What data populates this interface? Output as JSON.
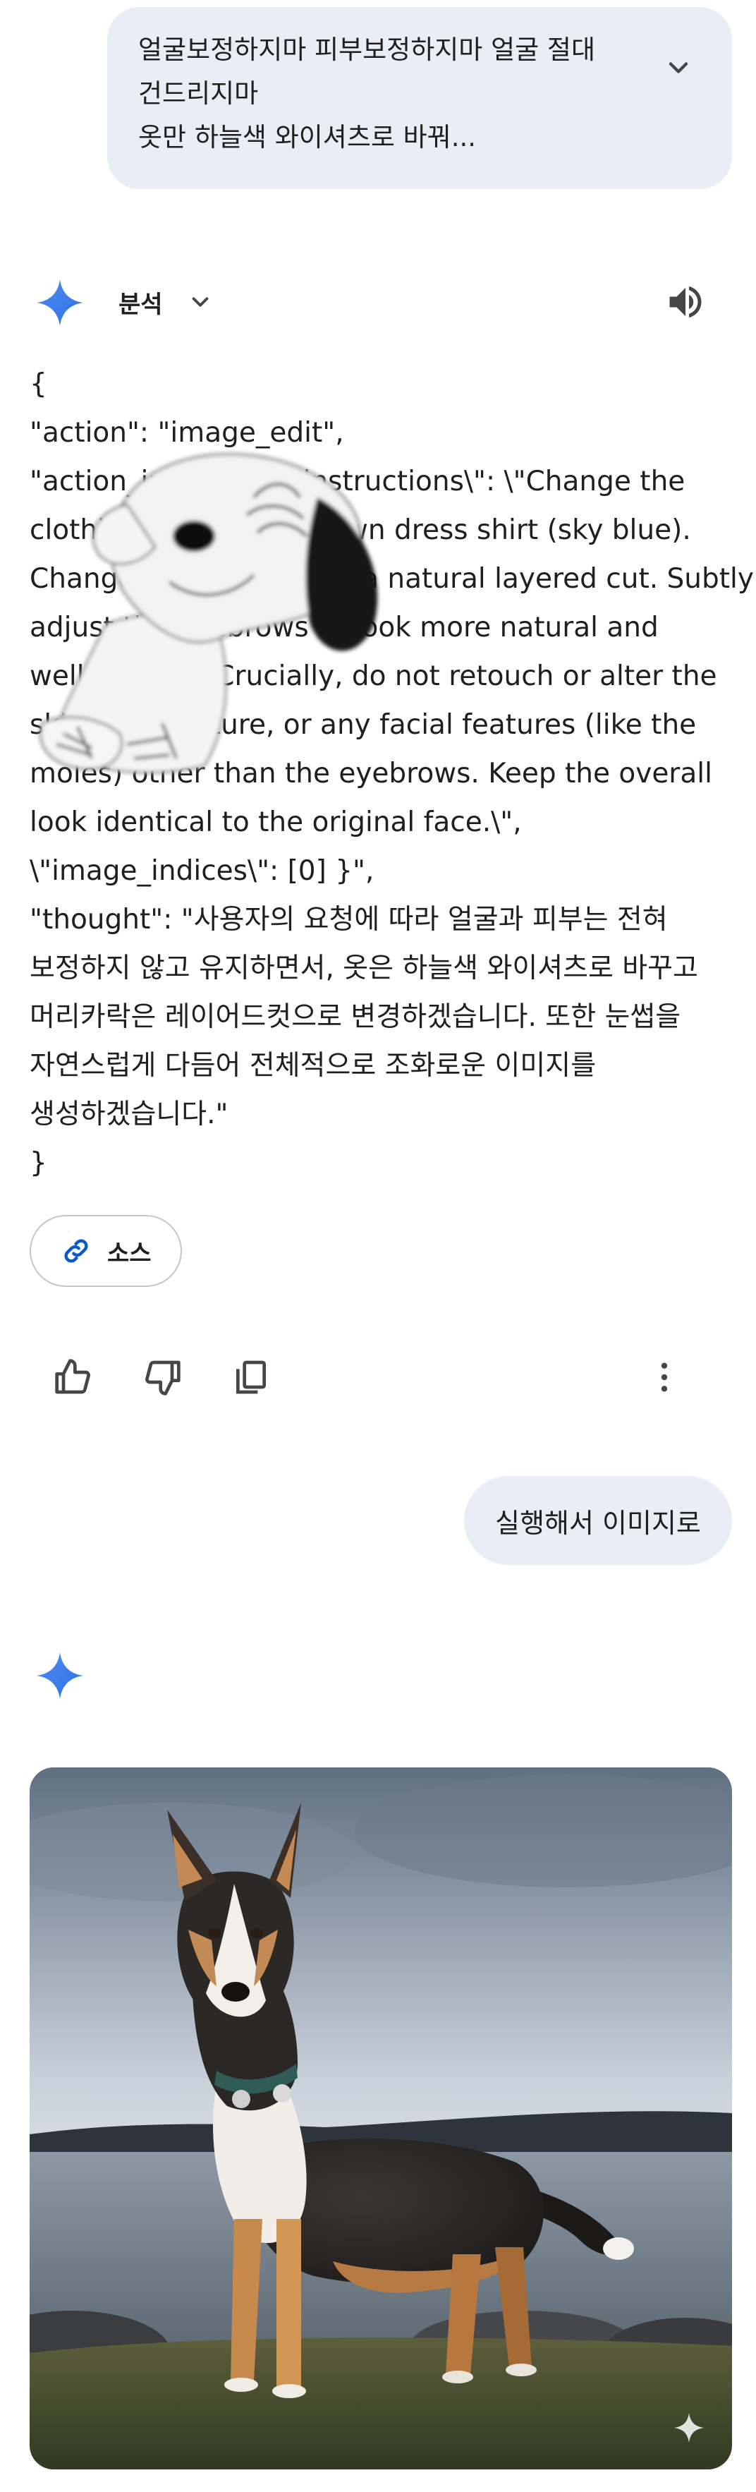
{
  "user_prompt": {
    "lines": [
      "얼굴보정하지마 피부보정하지마 얼굴 절대",
      "건드리지마",
      "옷만 하늘색 와이셔츠로 바꿔..."
    ],
    "expand_icon": "chevron-down-icon"
  },
  "response_header": {
    "mode_label": "분석",
    "mode_toggle_icon": "chevron-down-icon",
    "read_aloud_icon": "speaker-icon",
    "gemini_icon": "sparkle-icon"
  },
  "code_lines": [
    "{",
    "\"action\": \"image_edit\",",
    "\"action_input\": \"{ \\\"instructions\\\": \\\"Change the",
    "clothing to a button-down dress shirt (sky blue).",
    "Change the hairstyle to a natural layered cut. Subtly",
    "adjust the eyebrows to look more natural and",
    "well-defined. Crucially, do not retouch or alter the",
    "skin, skin texture, or any facial features (like the",
    "moles) other than the eyebrows. Keep the overall",
    "look identical to the original face.\\\",",
    "\\\"image_indices\\\": [0] }\",",
    "\"thought\": \"사용자의 요청에 따라 얼굴과 피부는 전혀",
    "보정하지 않고 유지하면서, 옷은 하늘색 와이셔츠로 바꾸고",
    "머리카락은 레이어드컷으로 변경하겠습니다. 또한 눈썹을",
    "자연스럽게 다듬어 전체적으로 조화로운 이미지를",
    "생성하겠습니다.\"",
    "}"
  ],
  "sources_chip": {
    "label": "소스",
    "icon": "link-icon"
  },
  "feedback_actions": {
    "thumbs_up_icon": "thumbs-up-icon",
    "thumbs_down_icon": "thumbs-down-icon",
    "copy_icon": "copy-icon",
    "more_icon": "more-vert-icon"
  },
  "second_prompt": {
    "text": "실행해서 이미지로"
  },
  "generated_image": {
    "watermark_icon": "sparkle-icon"
  },
  "colors": {
    "bubble_bg": "#e9eef6",
    "gemini_blue": "#4285f4",
    "icon_gray": "#444746",
    "chip_border": "#c4c7c5"
  }
}
